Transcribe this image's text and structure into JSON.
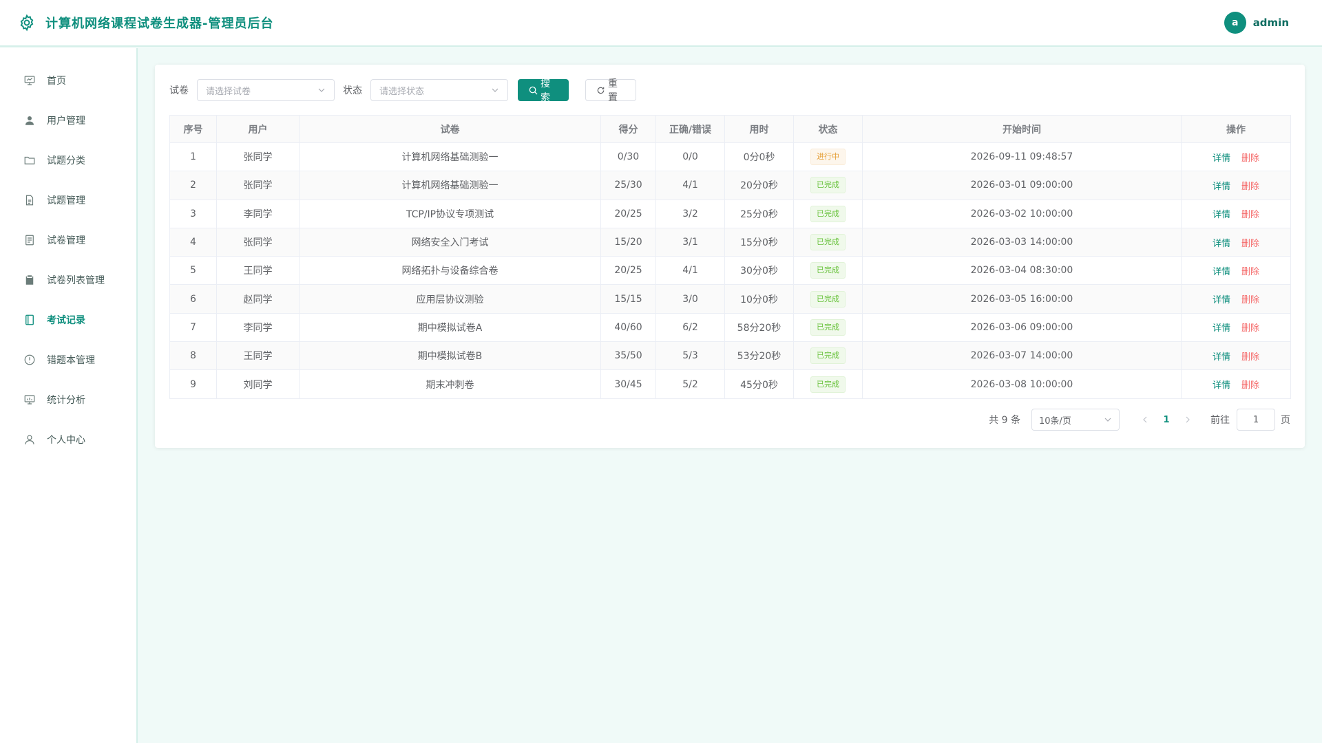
{
  "header": {
    "title": "计算机网络课程试卷生成器-管理员后台",
    "avatar_letter": "a",
    "username": "admin"
  },
  "sidebar": {
    "items": [
      {
        "label": "首页",
        "icon": "dashboard-icon"
      },
      {
        "label": "用户管理",
        "icon": "user-icon"
      },
      {
        "label": "试题分类",
        "icon": "folder-icon"
      },
      {
        "label": "试题管理",
        "icon": "document-icon"
      },
      {
        "label": "试卷管理",
        "icon": "paper-icon"
      },
      {
        "label": "试卷列表管理",
        "icon": "clipboard-icon"
      },
      {
        "label": "考试记录",
        "icon": "notebook-icon",
        "active": true
      },
      {
        "label": "错题本管理",
        "icon": "warning-icon"
      },
      {
        "label": "统计分析",
        "icon": "chart-icon"
      },
      {
        "label": "个人中心",
        "icon": "profile-icon"
      }
    ]
  },
  "filters": {
    "paper_label": "试卷",
    "paper_placeholder": "请选择试卷",
    "status_label": "状态",
    "status_placeholder": "请选择状态",
    "search_label": "搜索",
    "reset_label": "重置"
  },
  "table": {
    "headers": [
      "序号",
      "用户",
      "试卷",
      "得分",
      "正确/错误",
      "用时",
      "状态",
      "开始时间",
      "操作"
    ],
    "rows": [
      {
        "no": "1",
        "user": "张同学",
        "paper": "计算机网络基础测验一",
        "score": "0/30",
        "ratio": "0/0",
        "time": "0分0秒",
        "status": "进行中",
        "status_type": "warning",
        "start": "2026-09-11 09:48:57"
      },
      {
        "no": "2",
        "user": "张同学",
        "paper": "计算机网络基础测验一",
        "score": "25/30",
        "ratio": "4/1",
        "time": "20分0秒",
        "status": "已完成",
        "status_type": "success",
        "start": "2026-03-01 09:00:00"
      },
      {
        "no": "3",
        "user": "李同学",
        "paper": "TCP/IP协议专项测试",
        "score": "20/25",
        "ratio": "3/2",
        "time": "25分0秒",
        "status": "已完成",
        "status_type": "success",
        "start": "2026-03-02 10:00:00"
      },
      {
        "no": "4",
        "user": "张同学",
        "paper": "网络安全入门考试",
        "score": "15/20",
        "ratio": "3/1",
        "time": "15分0秒",
        "status": "已完成",
        "status_type": "success",
        "start": "2026-03-03 14:00:00"
      },
      {
        "no": "5",
        "user": "王同学",
        "paper": "网络拓扑与设备综合卷",
        "score": "20/25",
        "ratio": "4/1",
        "time": "30分0秒",
        "status": "已完成",
        "status_type": "success",
        "start": "2026-03-04 08:30:00"
      },
      {
        "no": "6",
        "user": "赵同学",
        "paper": "应用层协议测验",
        "score": "15/15",
        "ratio": "3/0",
        "time": "10分0秒",
        "status": "已完成",
        "status_type": "success",
        "start": "2026-03-05 16:00:00"
      },
      {
        "no": "7",
        "user": "李同学",
        "paper": "期中模拟试卷A",
        "score": "40/60",
        "ratio": "6/2",
        "time": "58分20秒",
        "status": "已完成",
        "status_type": "success",
        "start": "2026-03-06 09:00:00"
      },
      {
        "no": "8",
        "user": "王同学",
        "paper": "期中模拟试卷B",
        "score": "35/50",
        "ratio": "5/3",
        "time": "53分20秒",
        "status": "已完成",
        "status_type": "success",
        "start": "2026-03-07 14:00:00"
      },
      {
        "no": "9",
        "user": "刘同学",
        "paper": "期末冲刺卷",
        "score": "30/45",
        "ratio": "5/2",
        "time": "45分0秒",
        "status": "已完成",
        "status_type": "success",
        "start": "2026-03-08 10:00:00"
      }
    ],
    "view_label": "详情",
    "delete_label": "删除"
  },
  "pagination": {
    "total": "共 9 条",
    "page_size": "10条/页",
    "current": "1",
    "jump_label": "前往",
    "jump_value": "1",
    "jump_unit": "页"
  },
  "colors": {
    "primary": "#0f8f7e",
    "danger": "#f56c6c",
    "warning": "#e6a23c",
    "success": "#67c23a"
  }
}
